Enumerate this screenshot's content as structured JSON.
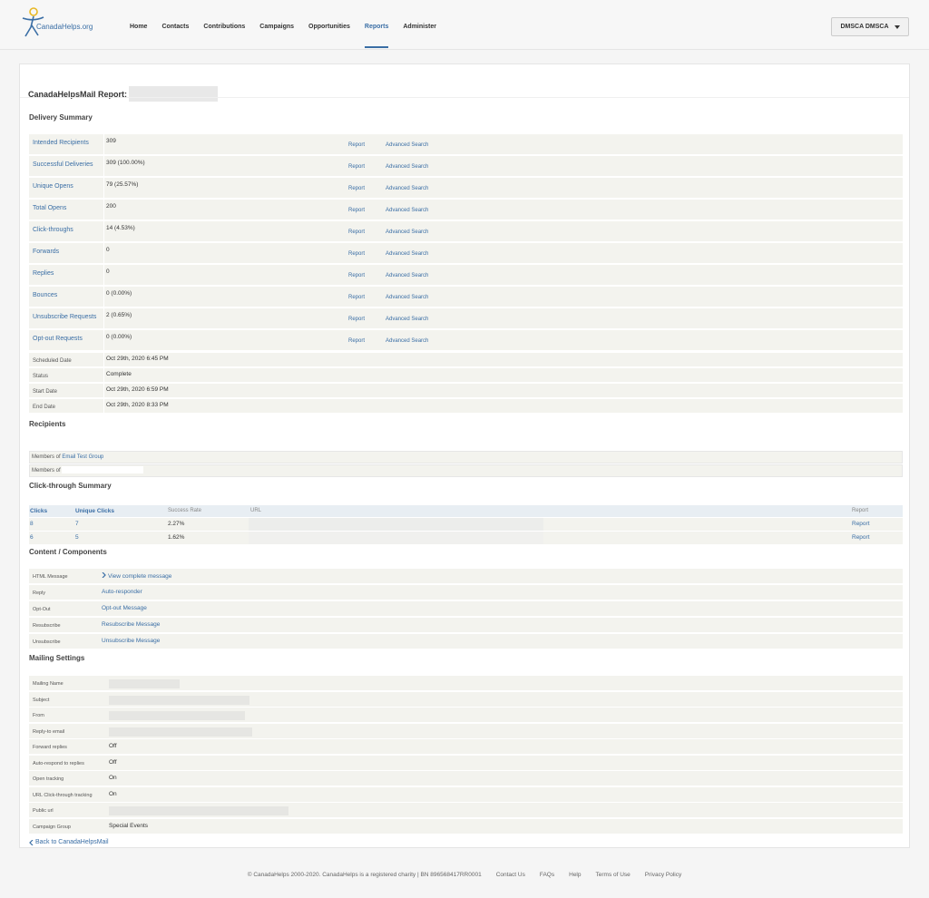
{
  "header": {
    "logo_text": "CanadaHelps.org",
    "nav": [
      "Home",
      "Contacts",
      "Contributions",
      "Campaigns",
      "Opportunities",
      "Reports",
      "Administer"
    ],
    "active_nav": "Reports",
    "user_button": "DMSCA DMSCA"
  },
  "report": {
    "title": "CanadaHelpsMail Report:"
  },
  "delivery_summary": {
    "title": "Delivery Summary",
    "report_label": "Report",
    "advanced_label": "Advanced Search",
    "rows": [
      {
        "label": "Intended Recipients",
        "value": "309"
      },
      {
        "label": "Successful Deliveries",
        "value": "309 (100.00%)"
      },
      {
        "label": "Unique Opens",
        "value": "79 (25.57%)"
      },
      {
        "label": "Total Opens",
        "value": "200"
      },
      {
        "label": "Click-throughs",
        "value": "14 (4.53%)"
      },
      {
        "label": "Forwards",
        "value": "0"
      },
      {
        "label": "Replies",
        "value": "0"
      },
      {
        "label": "Bounces",
        "value": "0 (0.00%)"
      },
      {
        "label": "Unsubscribe Requests",
        "value": "2 (0.65%)"
      },
      {
        "label": "Opt-out Requests",
        "value": "0 (0.00%)"
      }
    ],
    "info_rows": [
      {
        "label": "Scheduled Date",
        "value": "Oct 29th, 2020 6:45 PM"
      },
      {
        "label": "Status",
        "value": "Complete"
      },
      {
        "label": "Start Date",
        "value": "Oct 29th, 2020 6:59 PM"
      },
      {
        "label": "End Date",
        "value": "Oct 29th, 2020 8:33 PM"
      }
    ]
  },
  "recipients": {
    "title": "Recipients",
    "members_prefix": "Members of",
    "group_link": "Email Test Group",
    "members_prefix_2": "Members of"
  },
  "click_through": {
    "title": "Click-through Summary",
    "headers": {
      "clicks": "Clicks",
      "unique": "Unique Clicks",
      "rate": "Success Rate",
      "url": "URL",
      "report": "Report"
    },
    "rows": [
      {
        "clicks": "8",
        "unique": "7",
        "rate": "2.27%",
        "report": "Report"
      },
      {
        "clicks": "6",
        "unique": "5",
        "rate": "1.62%",
        "report": "Report"
      }
    ]
  },
  "content": {
    "title": "Content / Components",
    "rows": [
      {
        "label": "HTML Message",
        "value": "View complete message"
      },
      {
        "label": "Reply",
        "value": "Auto-responder"
      },
      {
        "label": "Opt-Out",
        "value": "Opt-out Message"
      },
      {
        "label": "Resubscribe",
        "value": "Resubscribe Message"
      },
      {
        "label": "Unsubscribe",
        "value": "Unsubscribe Message"
      }
    ]
  },
  "mailing_settings": {
    "title": "Mailing Settings",
    "rows": [
      {
        "label": "Mailing Name",
        "value": ""
      },
      {
        "label": "Subject",
        "value": ""
      },
      {
        "label": "From",
        "value": ""
      },
      {
        "label": "Reply-to email",
        "value": ""
      },
      {
        "label": "Forward replies",
        "value": "Off"
      },
      {
        "label": "Auto-respond to replies",
        "value": "Off"
      },
      {
        "label": "Open tracking",
        "value": "On"
      },
      {
        "label": "URL Click-through tracking",
        "value": "On"
      },
      {
        "label": "Public url",
        "value": ""
      },
      {
        "label": "Campaign Group",
        "value": "Special Events"
      }
    ]
  },
  "back_link": "Back to CanadaHelpsMail",
  "footer": {
    "copyright": "© CanadaHelps 2000-2020. CanadaHelps is a registered charity | BN 896568417RR0001",
    "links": [
      "Contact Us",
      "FAQs",
      "Help",
      "Terms of Use",
      "Privacy Policy"
    ]
  },
  "colors": {
    "link": "#3a6ea5",
    "row_bg": "#f3f3ee"
  }
}
